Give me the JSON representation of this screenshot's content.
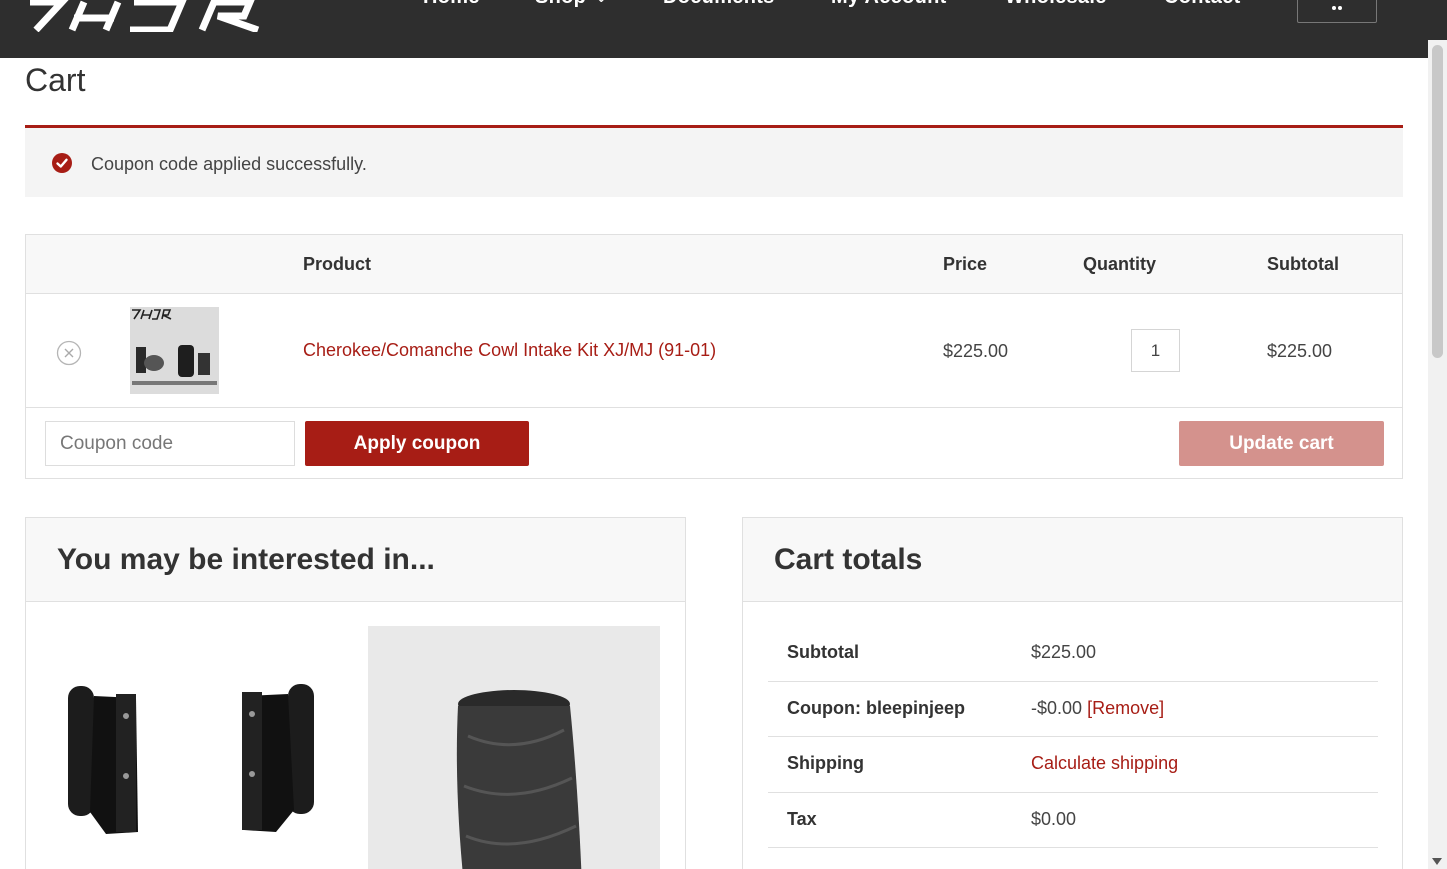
{
  "header": {
    "nav": [
      {
        "label": "Home"
      },
      {
        "label": "Shop"
      },
      {
        "label": "Documents"
      },
      {
        "label": "My Account"
      },
      {
        "label": "Wholesale"
      },
      {
        "label": "Contact"
      }
    ]
  },
  "page": {
    "title": "Cart"
  },
  "notice": {
    "message": "Coupon code applied successfully."
  },
  "cart_table": {
    "headers": {
      "product": "Product",
      "price": "Price",
      "quantity": "Quantity",
      "subtotal": "Subtotal"
    },
    "items": [
      {
        "name": "Cherokee/Comanche Cowl Intake Kit XJ/MJ (91-01)",
        "price": "$225.00",
        "quantity": "1",
        "subtotal": "$225.00"
      }
    ],
    "coupon_placeholder": "Coupon code",
    "apply_label": "Apply coupon",
    "update_label": "Update cart"
  },
  "cross_sells": {
    "title": "You may be interested in..."
  },
  "totals": {
    "title": "Cart totals",
    "rows": [
      {
        "label": "Subtotal",
        "value": "$225.00"
      },
      {
        "label": "Coupon: bleepinjeep",
        "value": "-$0.00",
        "link": "[Remove]"
      },
      {
        "label": "Shipping",
        "link": "Calculate shipping"
      },
      {
        "label": "Tax",
        "value": "$0.00"
      }
    ]
  },
  "colors": {
    "accent": "#a71d15",
    "header_bg": "#2e2e2e",
    "disabled_button": "#d4928d"
  }
}
